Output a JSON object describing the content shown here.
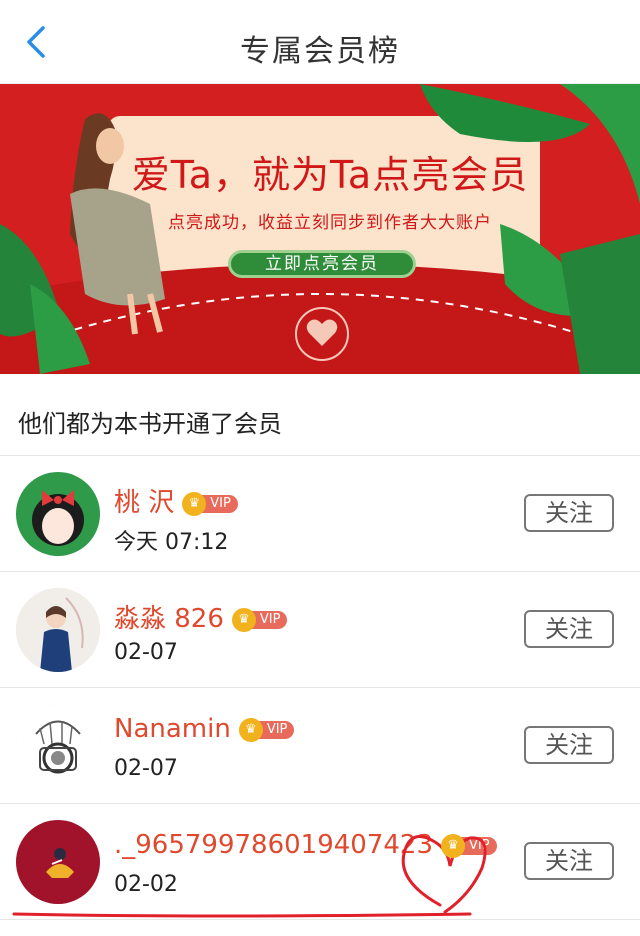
{
  "header": {
    "title": "专属会员榜"
  },
  "banner": {
    "headline": "爱Ta，就为Ta点亮会员",
    "subtext": "点亮成功，收益立刻同步到作者大大账户",
    "button_label": "立即点亮会员"
  },
  "section": {
    "title": "他们都为本书开通了会员"
  },
  "members": [
    {
      "name": "桃 沢",
      "badge": "VIP",
      "date": "今天 07:12",
      "follow_label": "关注"
    },
    {
      "name": "淼淼 826",
      "badge": "VIP",
      "date": "02-07",
      "follow_label": "关注"
    },
    {
      "name": "Nanamin",
      "badge": "VIP",
      "date": "02-07",
      "follow_label": "关注"
    },
    {
      "name": "._965799786019407423",
      "badge": "VIP",
      "date": "02-02",
      "follow_label": "关注"
    }
  ],
  "colors": {
    "accent": "#e0492e",
    "banner_red": "#d31f1f",
    "back_blue": "#2b8de8",
    "vip_gold": "#f2b21d"
  }
}
